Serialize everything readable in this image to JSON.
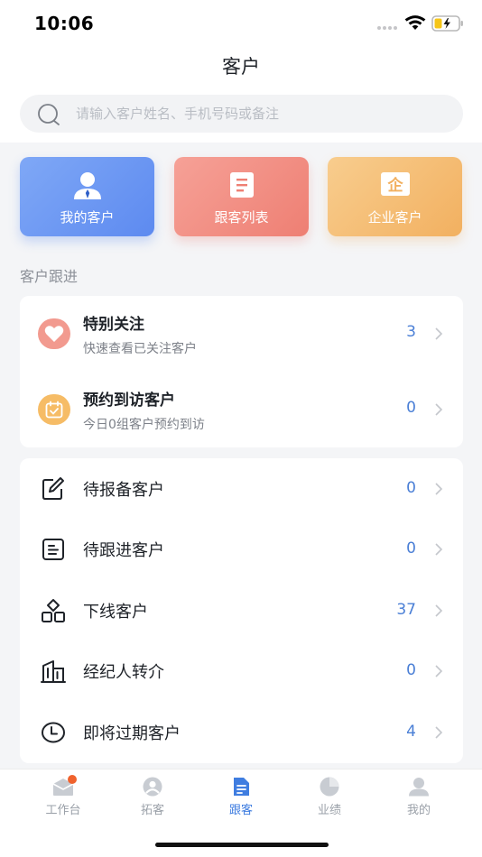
{
  "status_bar": {
    "time": "10:06"
  },
  "header": {
    "title": "客户"
  },
  "search": {
    "placeholder": "请输入客户姓名、手机号码或备注"
  },
  "quick_tiles": [
    {
      "label": "我的客户",
      "icon": "person-icon",
      "color": "#6b96f3"
    },
    {
      "label": "跟客列表",
      "icon": "document-icon",
      "color": "#f08e83"
    },
    {
      "label": "企业客户",
      "icon": "enterprise-icon",
      "color": "#f4bd72"
    }
  ],
  "follow_section": {
    "title": "客户跟进",
    "items": [
      {
        "title": "特别关注",
        "subtitle": "快速查看已关注客户",
        "count": "3",
        "icon": "heart-icon"
      },
      {
        "title": "预约到访客户",
        "subtitle": "今日0组客户预约到访",
        "count": "0",
        "icon": "calendar-icon"
      }
    ]
  },
  "customer_list": [
    {
      "label": "待报备客户",
      "count": "0",
      "icon": "edit-icon"
    },
    {
      "label": "待跟进客户",
      "count": "0",
      "icon": "list-icon"
    },
    {
      "label": "下线客户",
      "count": "37",
      "icon": "hierarchy-icon"
    },
    {
      "label": "经纪人转介",
      "count": "0",
      "icon": "building-icon"
    },
    {
      "label": "即将过期客户",
      "count": "4",
      "icon": "clock-icon"
    }
  ],
  "tabbar": {
    "active": "跟客",
    "items": [
      {
        "label": "工作台",
        "icon": "workbench-icon",
        "has_badge": true
      },
      {
        "label": "拓客",
        "icon": "user-circle-icon"
      },
      {
        "label": "跟客",
        "icon": "document-icon"
      },
      {
        "label": "业绩",
        "icon": "pie-chart-icon"
      },
      {
        "label": "我的",
        "icon": "profile-icon"
      }
    ]
  },
  "colors": {
    "accent": "#3f7de0",
    "count": "#4a7fd6",
    "badge": "#f0622d",
    "page_bg": "#f4f5f7"
  }
}
